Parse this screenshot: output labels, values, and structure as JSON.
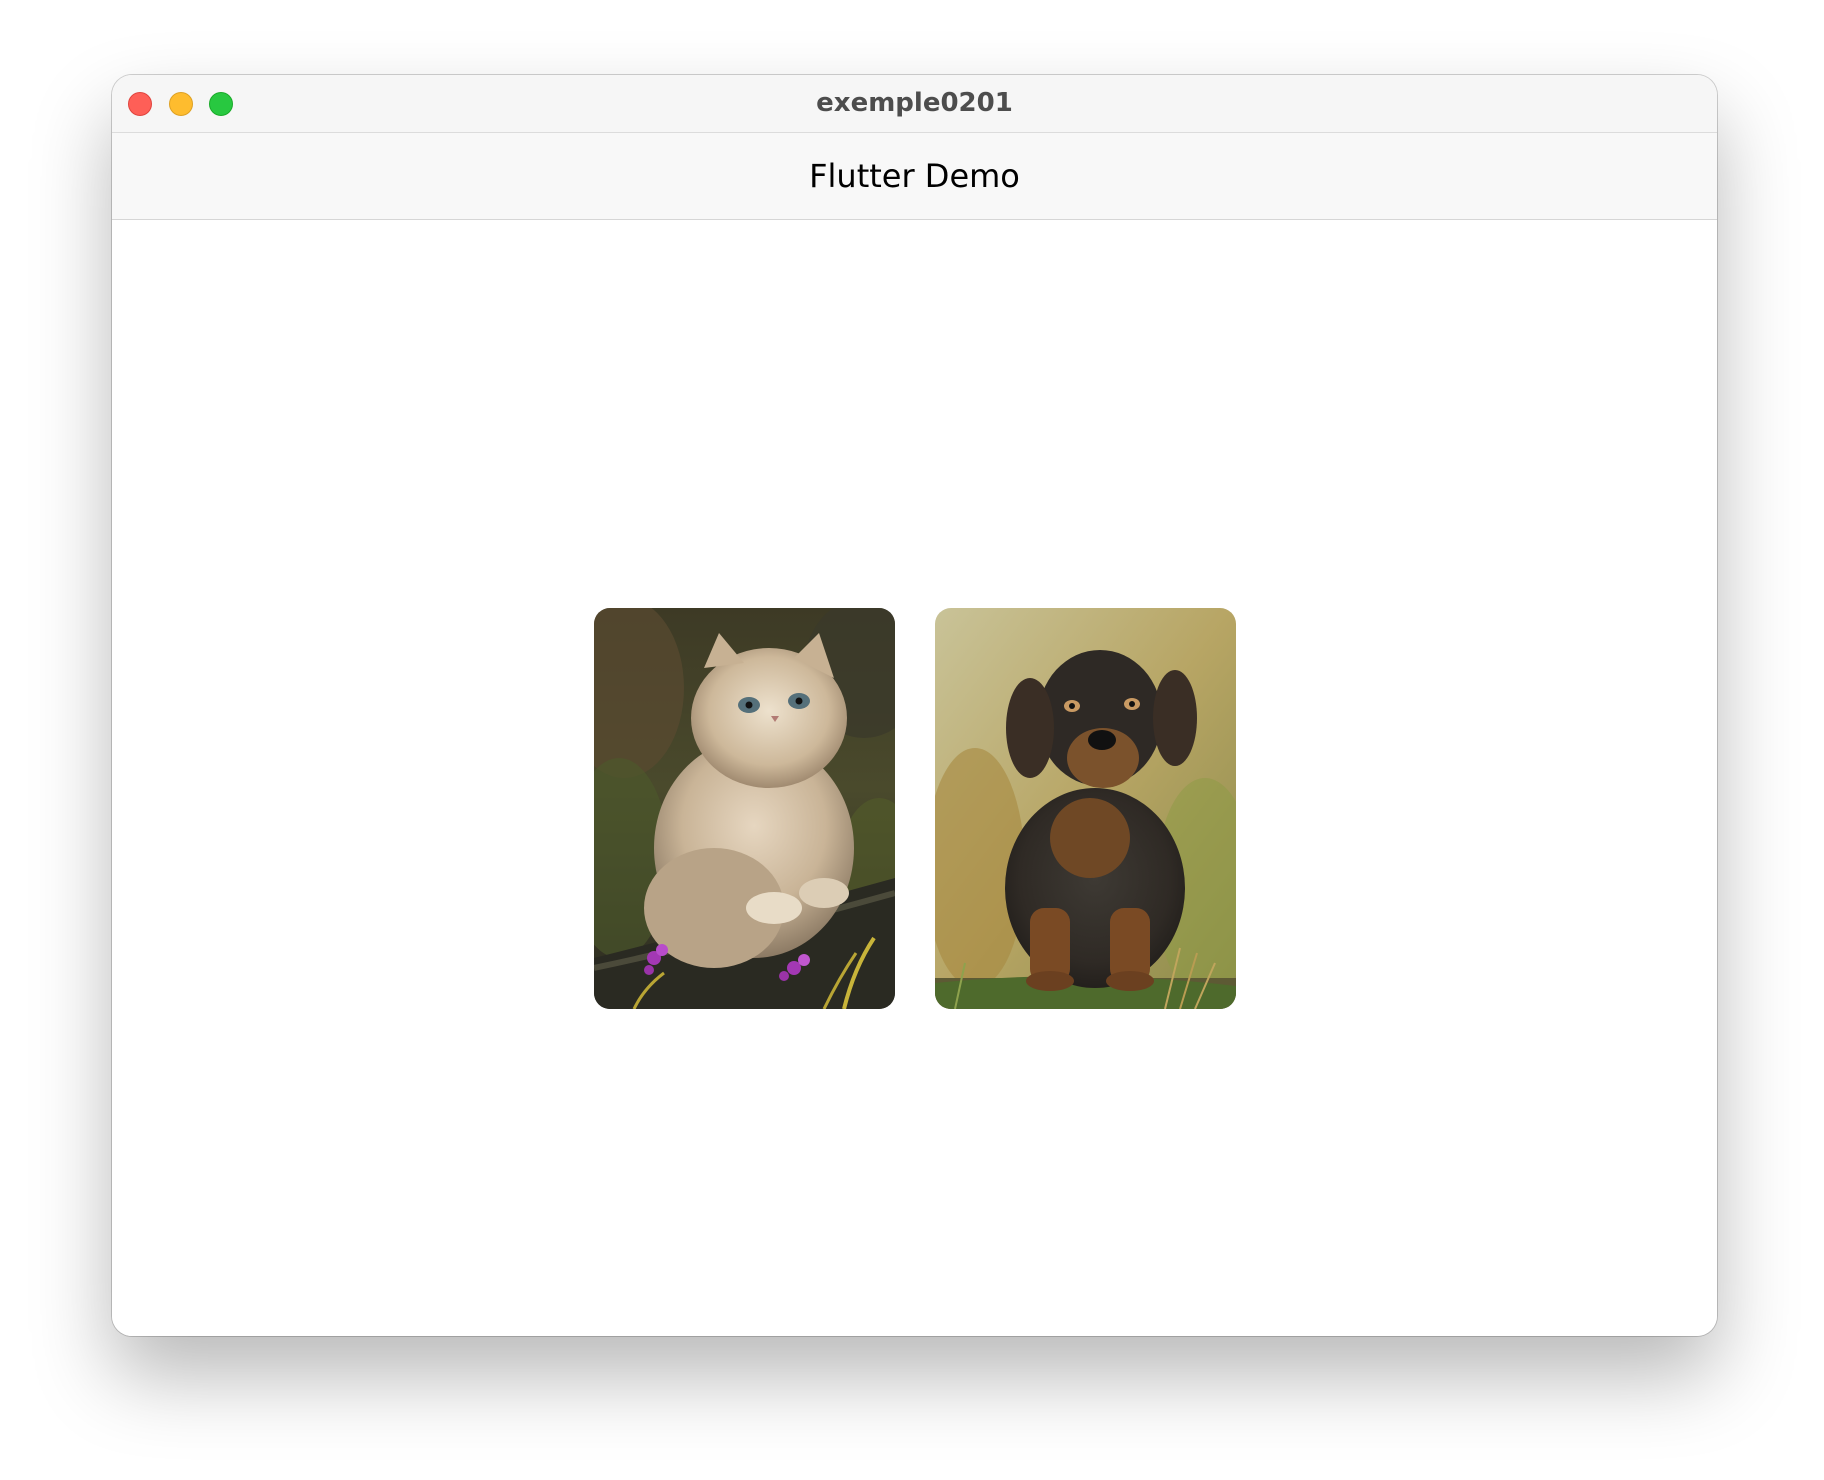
{
  "window": {
    "title": "exemple0201"
  },
  "appbar": {
    "title": "Flutter Demo"
  },
  "images": [
    {
      "subject": "cat"
    },
    {
      "subject": "dog"
    }
  ]
}
